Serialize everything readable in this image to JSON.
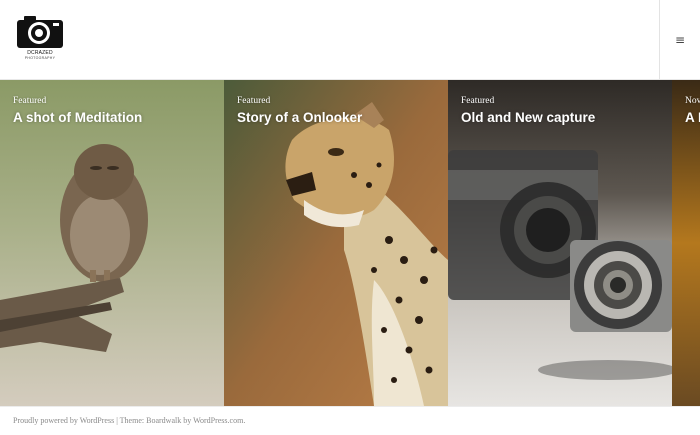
{
  "site": {
    "logo_name": "DCRAZED",
    "logo_tagline": "PHOTOGRAPHY"
  },
  "header": {
    "menu_icon": "hamburger-menu-icon",
    "menu_glyph": "≡"
  },
  "posts": [
    {
      "category": "Featured",
      "title": "A shot of Meditation",
      "image": "owl-on-branch"
    },
    {
      "category": "Featured",
      "title": "Story of a Onlooker",
      "image": "leopard-portrait"
    },
    {
      "category": "Featured",
      "title": "Old and New capture",
      "image": "vintage-camera-lens"
    },
    {
      "category": "Nov",
      "title": "A D",
      "image": "partial-orange-photo"
    }
  ],
  "footer": {
    "powered": "Proudly powered by WordPress",
    "separator": " | ",
    "theme_prefix": "Theme: ",
    "theme_link": "Boardwalk by WordPress.com",
    "period": "."
  },
  "colors": {
    "header_bg": "#ffffff",
    "footer_text": "#8a8a8a",
    "caption_text": "#ffffff"
  }
}
